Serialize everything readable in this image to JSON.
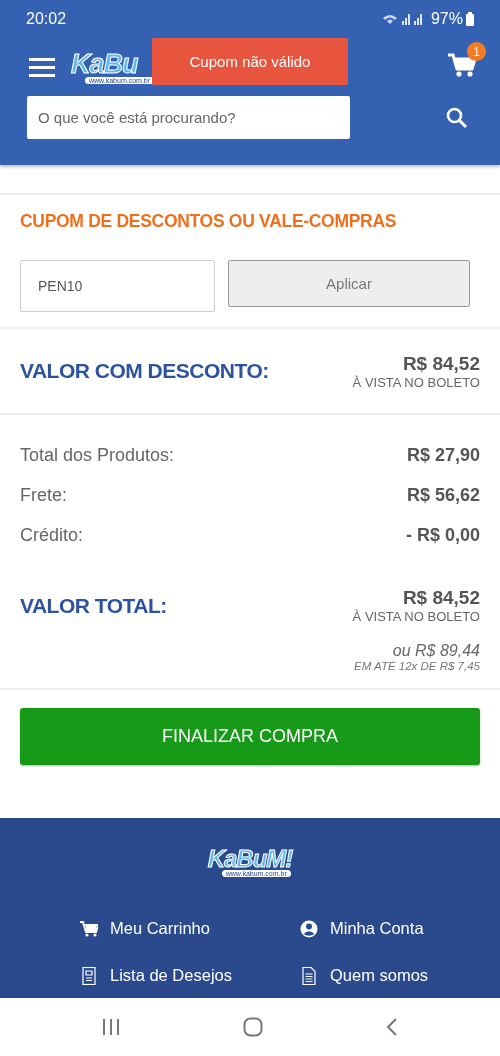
{
  "status_bar": {
    "time": "20:02",
    "battery": "97%"
  },
  "header": {
    "logo": "KaBu",
    "logo_url": "www.kabum.com.br",
    "cart_count": "1",
    "search": {
      "placeholder": "O que você está procurando?"
    }
  },
  "toast": {
    "text": "Cupom não válido"
  },
  "coupon": {
    "title": "CUPOM DE DESCONTOS OU VALE-COMPRAS",
    "value": "PEN10",
    "button": {
      "label": "Aplicar",
      "disabled": true
    }
  },
  "discount": {
    "label": "VALOR COM DESCONTO:",
    "price": "R$ 84,52",
    "note": "À VISTA NO BOLETO"
  },
  "summary": [
    {
      "label": "Total dos Produtos:",
      "value": "R$ 27,90"
    },
    {
      "label": "Frete:",
      "value": "R$ 56,62"
    },
    {
      "label": "Crédito:",
      "value": "- R$ 0,00"
    }
  ],
  "total": {
    "label": "VALOR TOTAL:",
    "price": "R$ 84,52",
    "note": "À VISTA NO BOLETO",
    "installment_price": "ou R$ 89,44",
    "installment_note": "EM ATÉ 12x DE R$ 7,45"
  },
  "checkout_button": "FINALIZAR COMPRA",
  "footer": {
    "logo": "KaBuM!",
    "logo_url": "www.kabum.com.br",
    "links": [
      {
        "kind": "cart",
        "label": "Meu Carrinho"
      },
      {
        "kind": "account",
        "label": "Minha Conta"
      },
      {
        "kind": "wishlist",
        "label": "Lista de Desejos"
      },
      {
        "kind": "about",
        "label": "Quem somos"
      }
    ]
  }
}
